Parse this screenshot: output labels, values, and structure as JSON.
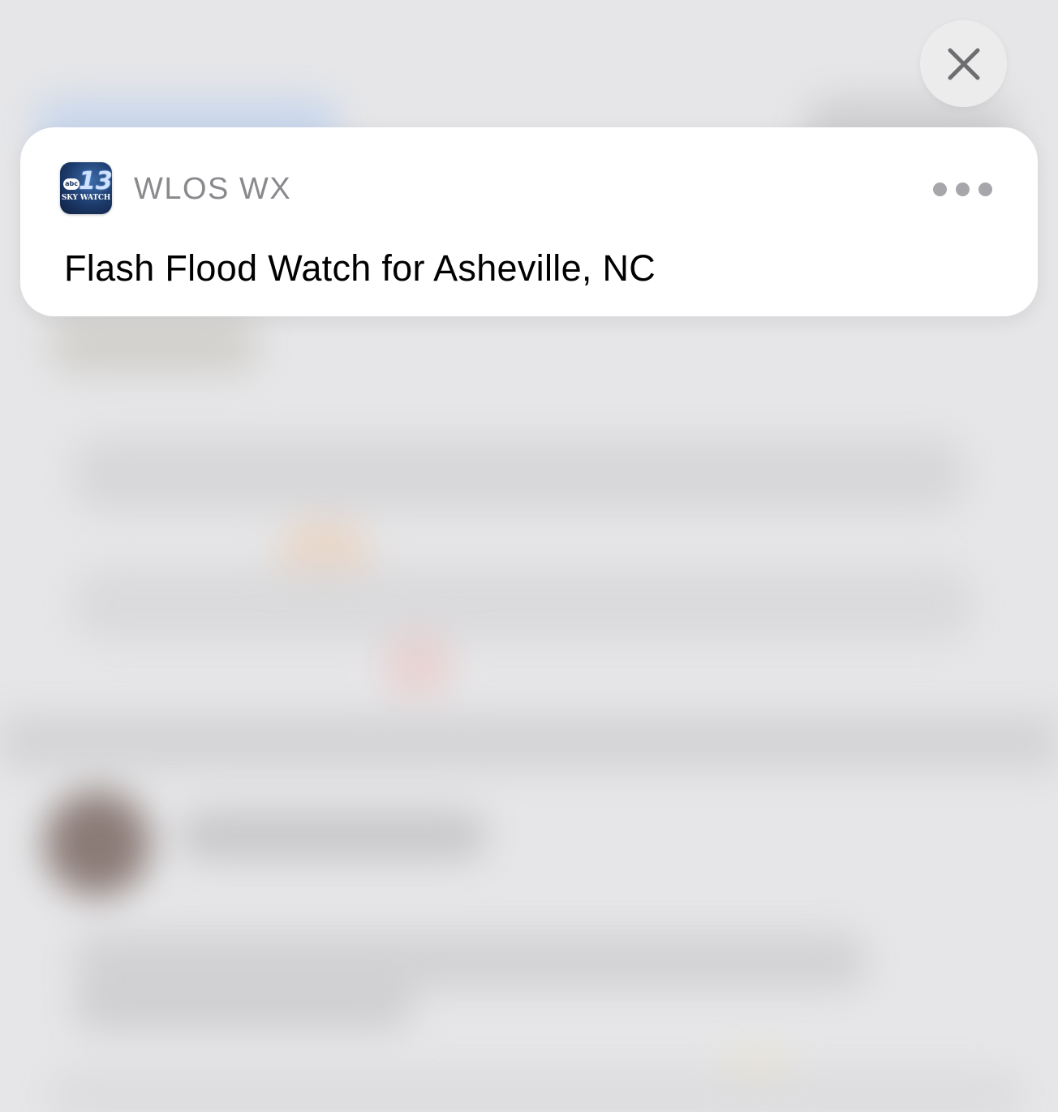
{
  "close_button": {
    "icon": "close-icon",
    "label": ""
  },
  "notification": {
    "app_icon": {
      "icon": "wlos-skywatch-app-icon",
      "logo_text_abc": "abc",
      "logo_text_number": "13",
      "logo_text_sky": "SKY WATCH"
    },
    "app_name": "WLOS WX",
    "more_icon": "ellipsis-icon",
    "message": "Flash Flood Watch for Asheville, NC"
  },
  "colors": {
    "card_background": "#ffffff",
    "app_name_color": "#8a8a8e",
    "message_color": "#000000",
    "close_button_background": "#ececec"
  }
}
